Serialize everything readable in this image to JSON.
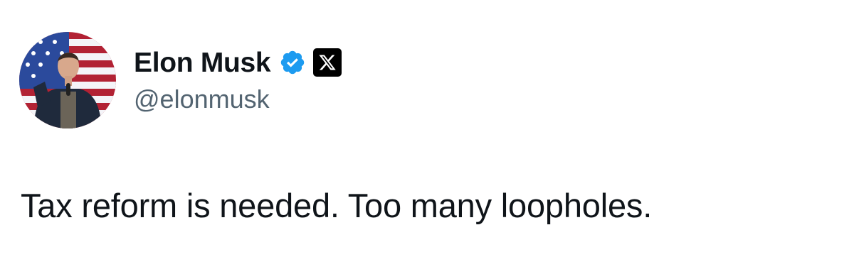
{
  "author": {
    "display_name": "Elon Musk",
    "handle": "@elonmusk",
    "verified": true,
    "verified_color": "#1d9bf0",
    "affiliation_badge": "x-logo-icon",
    "name_color": "#0f1419",
    "handle_color": "#536471"
  },
  "tweet": {
    "text": "Tax reform is needed. Too many loopholes."
  },
  "icons": {
    "verified": "verified-checkmark-icon",
    "affiliation": "x-logo-icon"
  }
}
